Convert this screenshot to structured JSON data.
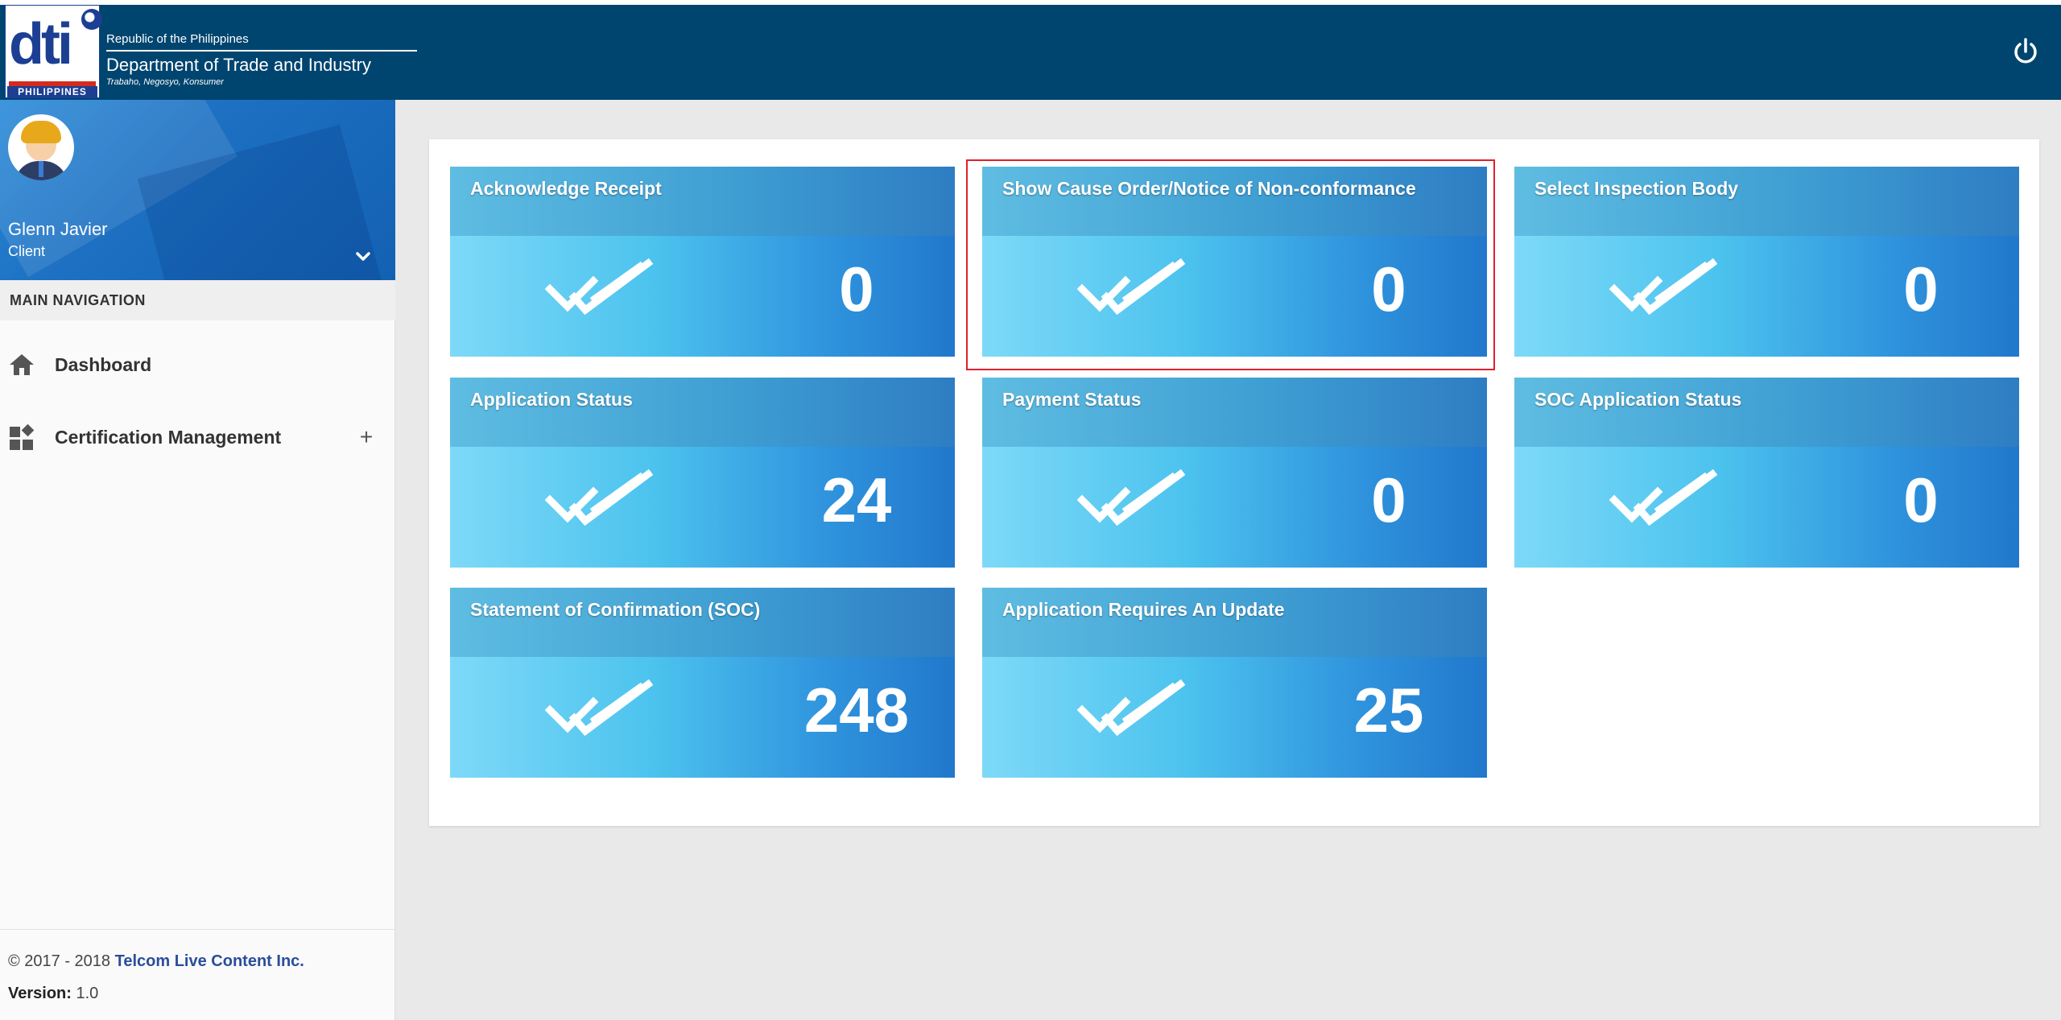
{
  "header": {
    "logo_text": "dti",
    "logo_country": "PHILIPPINES",
    "republic": "Republic of the Philippines",
    "department": "Department of Trade and Industry",
    "tagline": "Trabaho, Negosyo, Konsumer",
    "power_icon": "power-icon"
  },
  "user": {
    "name": "Glenn Javier",
    "role": "Client"
  },
  "sidebar": {
    "nav_header": "MAIN NAVIGATION",
    "items": [
      {
        "label": "Dashboard",
        "icon": "home-icon"
      },
      {
        "label": "Certification Management",
        "icon": "apps-icon",
        "expand": "+"
      }
    ],
    "footer": {
      "copyright_prefix": "© 2017 - 2018",
      "company": "Telcom Live Content Inc.",
      "version_label": "Version:",
      "version_value": "1.0"
    }
  },
  "tiles": [
    {
      "title": "Acknowledge Receipt",
      "count": "0"
    },
    {
      "title": "Show Cause Order/Notice of Non-conformance",
      "count": "0"
    },
    {
      "title": "Select Inspection Body",
      "count": "0"
    },
    {
      "title": "Application Status",
      "count": "24"
    },
    {
      "title": "Payment Status",
      "count": "0"
    },
    {
      "title": "SOC Application Status",
      "count": "0"
    },
    {
      "title": "Statement of Confirmation (SOC)",
      "count": "248"
    },
    {
      "title": "Application Requires An Update",
      "count": "25"
    }
  ],
  "colors": {
    "header_bg": "#00456f",
    "highlight": "#e0202a",
    "link_company": "#2a4d9b"
  }
}
